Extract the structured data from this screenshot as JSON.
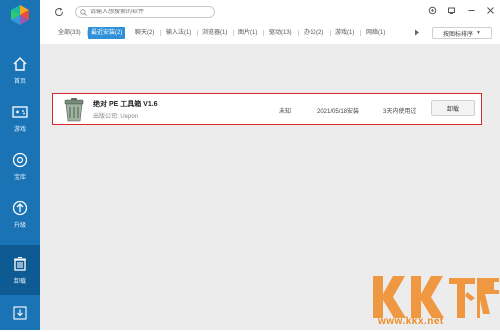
{
  "search": {
    "placeholder": "请输入想搜索的软件"
  },
  "sidebar": {
    "items": [
      {
        "label": "首页",
        "icon": "home-icon"
      },
      {
        "label": "游戏",
        "icon": "gamepad-icon"
      },
      {
        "label": "宝库",
        "icon": "treasure-icon"
      },
      {
        "label": "升级",
        "icon": "upgrade-icon"
      },
      {
        "label": "卸载",
        "icon": "trash-icon",
        "active": true
      }
    ],
    "bottom_icon": "download-icon"
  },
  "tabs": [
    {
      "label": "全部(33)"
    },
    {
      "label": "最近安装(2)",
      "active": true
    },
    {
      "label": "聊天(2)"
    },
    {
      "label": "输入法(1)"
    },
    {
      "label": "浏览器(1)"
    },
    {
      "label": "图片(1)"
    },
    {
      "label": "驱动(13)"
    },
    {
      "label": "办公(2)"
    },
    {
      "label": "游戏(1)"
    },
    {
      "label": "网络(1)"
    }
  ],
  "sort": {
    "label": "按图标排序"
  },
  "app": {
    "name": "绝对 PE 工具箱 V1.6",
    "publisher": "出版公司: Uepon",
    "size": "未知",
    "install_date": "2021/05/18安装",
    "usage": "3天内使用过",
    "uninstall_label": "卸载"
  },
  "watermark": {
    "text": "www.kkx.net",
    "logo_text": "KK下载"
  },
  "colors": {
    "sidebar": "#1a73b5",
    "sidebar_active": "#0e5a93",
    "tab_active": "#2f8fd8",
    "card_border": "#d9272d",
    "watermark": "#f08a24"
  }
}
